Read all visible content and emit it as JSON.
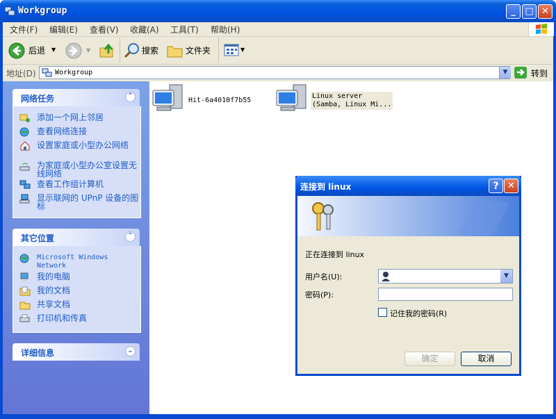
{
  "window": {
    "title": "Workgroup"
  },
  "menu": [
    "文件(F)",
    "编辑(E)",
    "查看(V)",
    "收藏(A)",
    "工具(T)",
    "帮助(H)"
  ],
  "toolbar": {
    "back": "后退",
    "search": "搜索",
    "folders": "文件夹"
  },
  "address": {
    "label": "地址(D)",
    "value": "Workgroup",
    "go": "转到"
  },
  "left_panel": {
    "network_tasks": {
      "title": "网络任务",
      "items": [
        "添加一个网上邻居",
        "查看网络连接",
        "设置家庭或小型办公网络",
        "为家庭或小型办公室设置无线网络",
        "查看工作组计算机",
        "显示联网的 UPnP 设备的图标"
      ]
    },
    "other_places": {
      "title": "其它位置",
      "items": [
        "Microsoft Windows Network",
        "我的电脑",
        "我的文档",
        "共享文档",
        "打印机和传真"
      ]
    },
    "details": {
      "title": "详细信息"
    }
  },
  "computers": [
    {
      "name": "Hit-6a4010f7b55"
    },
    {
      "name": "Linux server",
      "comment": "(Samba, Linux Mi..."
    }
  ],
  "dialog": {
    "title": "连接到 linux",
    "connecting_text": "正在连接到 linux",
    "username_label": "用户名(U):",
    "password_label": "密码(P):",
    "username_value": "",
    "password_value": "",
    "remember_label": "记住我的密码(R)",
    "ok": "确定",
    "cancel": "取消"
  },
  "colors": {
    "title_blue": "#0054e3",
    "task_link": "#215dc6",
    "panel_bg": "#6375d6"
  }
}
